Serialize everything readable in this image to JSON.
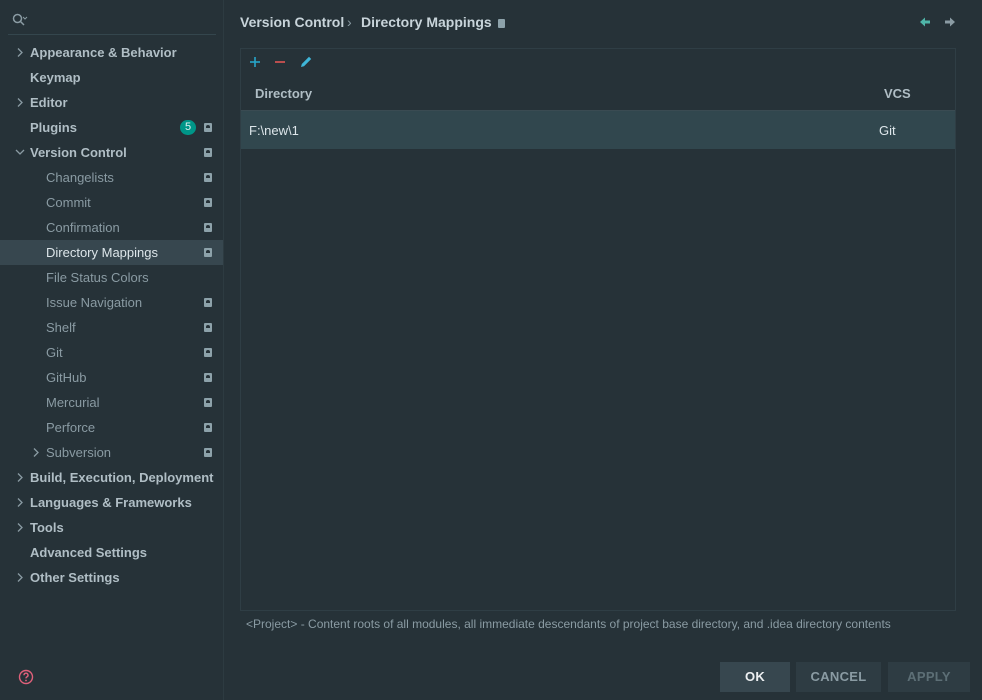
{
  "sidebar": {
    "search_placeholder": "",
    "items": [
      {
        "label": "Appearance & Behavior",
        "level": 0,
        "expandable": true,
        "expanded": false
      },
      {
        "label": "Keymap",
        "level": 0,
        "expandable": false
      },
      {
        "label": "Editor",
        "level": 0,
        "expandable": true,
        "expanded": false
      },
      {
        "label": "Plugins",
        "level": 0,
        "expandable": false,
        "badge": "5",
        "project_mark": true
      },
      {
        "label": "Version Control",
        "level": 0,
        "expandable": true,
        "expanded": true,
        "project_mark": true
      },
      {
        "label": "Changelists",
        "level": 1,
        "project_mark": true
      },
      {
        "label": "Commit",
        "level": 1,
        "project_mark": true
      },
      {
        "label": "Confirmation",
        "level": 1,
        "project_mark": true
      },
      {
        "label": "Directory Mappings",
        "level": 1,
        "project_mark": true,
        "selected": true
      },
      {
        "label": "File Status Colors",
        "level": 1
      },
      {
        "label": "Issue Navigation",
        "level": 1,
        "project_mark": true
      },
      {
        "label": "Shelf",
        "level": 1,
        "project_mark": true
      },
      {
        "label": "Git",
        "level": 1,
        "project_mark": true
      },
      {
        "label": "GitHub",
        "level": 1,
        "project_mark": true
      },
      {
        "label": "Mercurial",
        "level": 1,
        "project_mark": true
      },
      {
        "label": "Perforce",
        "level": 1,
        "project_mark": true
      },
      {
        "label": "Subversion",
        "level": 1,
        "expandable": true,
        "expanded": false,
        "project_mark": true
      },
      {
        "label": "Build, Execution, Deployment",
        "level": 0,
        "expandable": true,
        "expanded": false
      },
      {
        "label": "Languages & Frameworks",
        "level": 0,
        "expandable": true,
        "expanded": false
      },
      {
        "label": "Tools",
        "level": 0,
        "expandable": true,
        "expanded": false
      },
      {
        "label": "Advanced Settings",
        "level": 0,
        "expandable": false
      },
      {
        "label": "Other Settings",
        "level": 0,
        "expandable": true,
        "expanded": false
      }
    ]
  },
  "breadcrumb": {
    "parent": "Version Control",
    "separator": "›",
    "current": "Directory Mappings"
  },
  "table": {
    "columns": [
      "Directory",
      "VCS"
    ],
    "rows": [
      {
        "directory": "F:\\new\\1",
        "vcs": "Git"
      }
    ]
  },
  "note": "<Project> - Content roots of all modules, all immediate descendants of project base directory, and .idea directory contents",
  "buttons": {
    "ok": "OK",
    "cancel": "CANCEL",
    "apply": "APPLY"
  },
  "colors": {
    "background": "#263238",
    "accent_teal": "#009688",
    "add_icon": "#26a6c9",
    "remove_icon": "#e05555",
    "edit_icon": "#3fb6d8",
    "selected_row": "#31474e"
  },
  "icons": [
    "search-icon",
    "add-icon",
    "remove-icon",
    "edit-icon",
    "back-arrow-icon",
    "forward-arrow-icon",
    "help-icon",
    "project-level-icon",
    "chevron-right-icon",
    "chevron-down-icon"
  ]
}
